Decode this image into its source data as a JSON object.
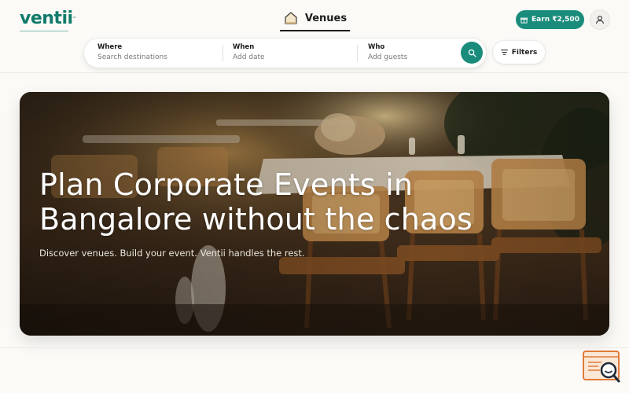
{
  "brand": {
    "name": "ventii",
    "trademark": "™",
    "tagline": "",
    "color": "#127a6a"
  },
  "nav": {
    "tab_label": "Venues",
    "tab_icon": "home-icon"
  },
  "header": {
    "earn_label": "Earn ₹2,500",
    "earn_icon": "gift-icon",
    "user_icon": "user-icon",
    "accent": "#1a8c7c"
  },
  "search": {
    "where_label": "Where",
    "where_placeholder": "Search destinations",
    "when_label": "When",
    "when_placeholder": "Add date",
    "who_label": "Who",
    "who_placeholder": "Add guests",
    "button_icon": "search-icon"
  },
  "filters": {
    "label": "Filters",
    "icon": "filter-lines-icon"
  },
  "hero": {
    "title": "Plan Corporate Events in Bangalore without the chaos",
    "subtitle": "Discover venues. Build your event. Ventii handles the rest.",
    "image": "outdoor dining tables with rattan chairs at night"
  },
  "support_widget": {
    "icon": "support-search-icon"
  }
}
